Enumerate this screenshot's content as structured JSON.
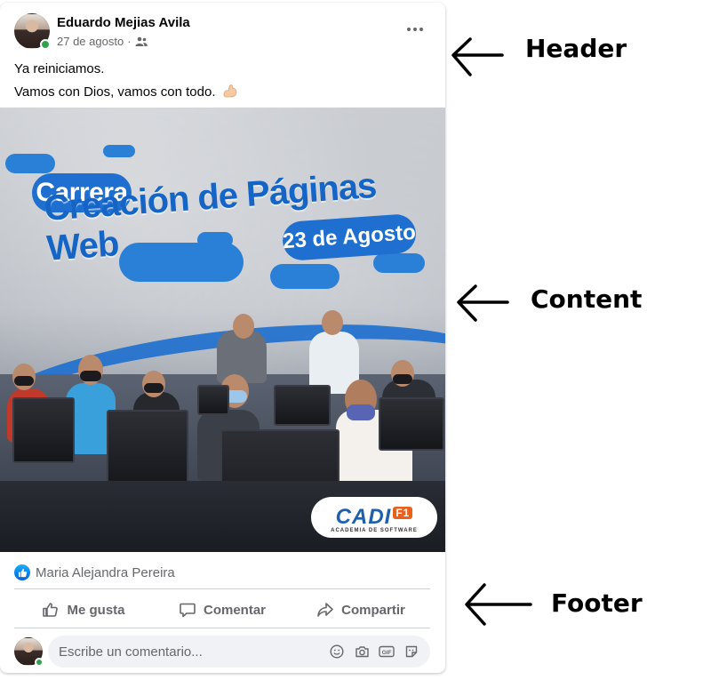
{
  "post": {
    "author": "Eduardo Mejias Avila",
    "date": "27 de agosto",
    "audience_icon": "friends-icon",
    "line1": "Ya reiniciamos.",
    "line2": "Vamos con Dios, vamos con todo.",
    "emoji_icon": "flexed-biceps-icon"
  },
  "image": {
    "tag": "Carrera",
    "headline": "Creación de Páginas Web",
    "date_text": "23 de Agosto",
    "logo_text": "CADI",
    "logo_badge": "F1",
    "logo_subtitle": "ACADEMIA DE SOFTWARE"
  },
  "footer": {
    "reactor": "Maria Alejandra Pereira",
    "like_label": "Me gusta",
    "comment_label": "Comentar",
    "share_label": "Compartir",
    "comment_placeholder": "Escribe un comentario..."
  },
  "annotations": {
    "header": "Header",
    "content": "Content",
    "footer": "Footer"
  },
  "colors": {
    "brand_blue": "#1e6fd0",
    "like_blue": "#0062df",
    "online_green": "#31a24c",
    "secondary_text": "#65676b"
  }
}
